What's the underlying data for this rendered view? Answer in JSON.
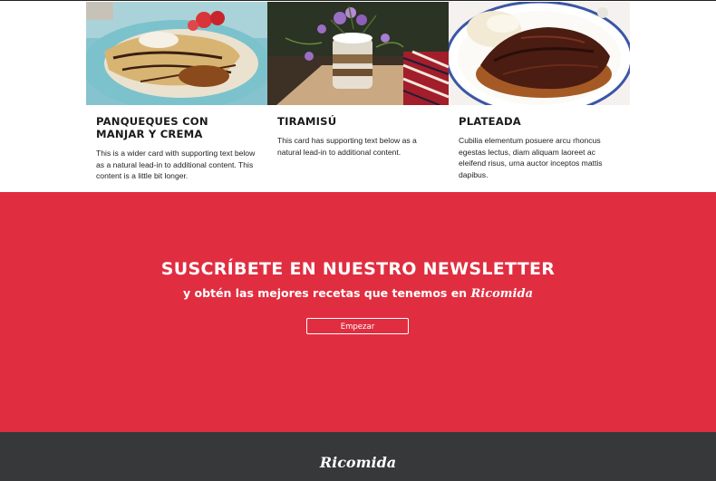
{
  "cards": [
    {
      "title": "PANQUEQUES CON MANJAR Y CREMA",
      "text": "This is a wider card with supporting text below as a natural lead-in to additional content. This content is a little bit longer.",
      "image_label": "pancakes-photo"
    },
    {
      "title": "TIRAMISÚ",
      "text": "This card has supporting text below as a natural lead-in to additional content.",
      "image_label": "tiramisu-photo"
    },
    {
      "title": "PLATEADA",
      "text": "Cubilia elementum posuere arcu rhoncus egestas lectus, diam aliquam laoreet ac eleifend risus, urna auctor inceptos mattis dapibus.",
      "image_label": "plateada-photo"
    }
  ],
  "newsletter": {
    "title": "SUSCRÍBETE EN NUESTRO NEWSLETTER",
    "subtitle": "y obtén las mejores recetas que tenemos en",
    "brand": "Ricomida",
    "button_label": "Empezar",
    "background_color": "#e02e40"
  },
  "footer": {
    "brand": "Ricomida",
    "background_color": "#363839"
  }
}
